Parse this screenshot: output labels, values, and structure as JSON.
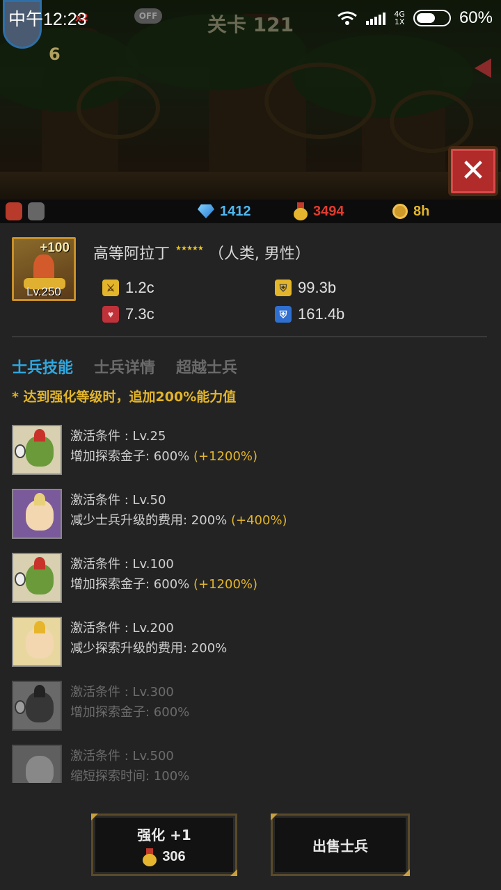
{
  "status_bar": {
    "time": "中午12:23",
    "network": "4G",
    "network_sub": "1X",
    "battery": "60%",
    "battery_level": 0.6
  },
  "scene": {
    "stage_title": "关卡 121",
    "auto_toggle": "OFF",
    "speed": "x2",
    "hero_level": "6"
  },
  "currency": {
    "gems": "1412",
    "medals": "3494",
    "time_coins": "8h",
    "gem_color": "#4fb8f0",
    "medal_color": "#e23b2e",
    "coin_color": "#e3b52b"
  },
  "unit": {
    "enhance": "+100",
    "level": "Lv.250",
    "name": "高等阿拉丁",
    "stars": "★★★★★",
    "traits": "（人类, 男性）",
    "stats": {
      "attack": "1.2c",
      "health": "7.3c",
      "defense": "99.3b",
      "magic_defense": "161.4b"
    }
  },
  "tabs": [
    {
      "label": "士兵技能",
      "active": true
    },
    {
      "label": "士兵详情",
      "active": false
    },
    {
      "label": "超越士兵",
      "active": false
    }
  ],
  "note": "* 达到强化等级时，追加200%能力值",
  "skills": [
    {
      "condition": "激活条件 : Lv.25",
      "effect": "增加探索金子: 600%",
      "bonus": "(+1200%)",
      "icon": "goblin-icon",
      "locked": false
    },
    {
      "condition": "激活条件 : Lv.50",
      "effect": "减少士兵升级的费用: 200%",
      "bonus": "(+400%)",
      "icon": "elf-girl-icon",
      "locked": false
    },
    {
      "condition": "激活条件 : Lv.100",
      "effect": "增加探索金子: 600%",
      "bonus": "(+1200%)",
      "icon": "goblin-icon",
      "locked": false
    },
    {
      "condition": "激活条件 : Lv.200",
      "effect": "减少探索升级的费用: 200%",
      "bonus": "",
      "icon": "elf-princess-icon",
      "locked": false
    },
    {
      "condition": "激活条件 : Lv.300",
      "effect": "增加探索金子: 600%",
      "bonus": "",
      "icon": "dark-goblin-icon",
      "locked": true
    },
    {
      "condition": "激活条件 : Lv.500",
      "effect": "缩短探索时间: 100%",
      "bonus": "",
      "icon": "ghost-icon",
      "locked": true
    }
  ],
  "buttons": {
    "enhance_label": "强化 +1",
    "enhance_cost": "306",
    "sell_label": "出售士兵"
  }
}
